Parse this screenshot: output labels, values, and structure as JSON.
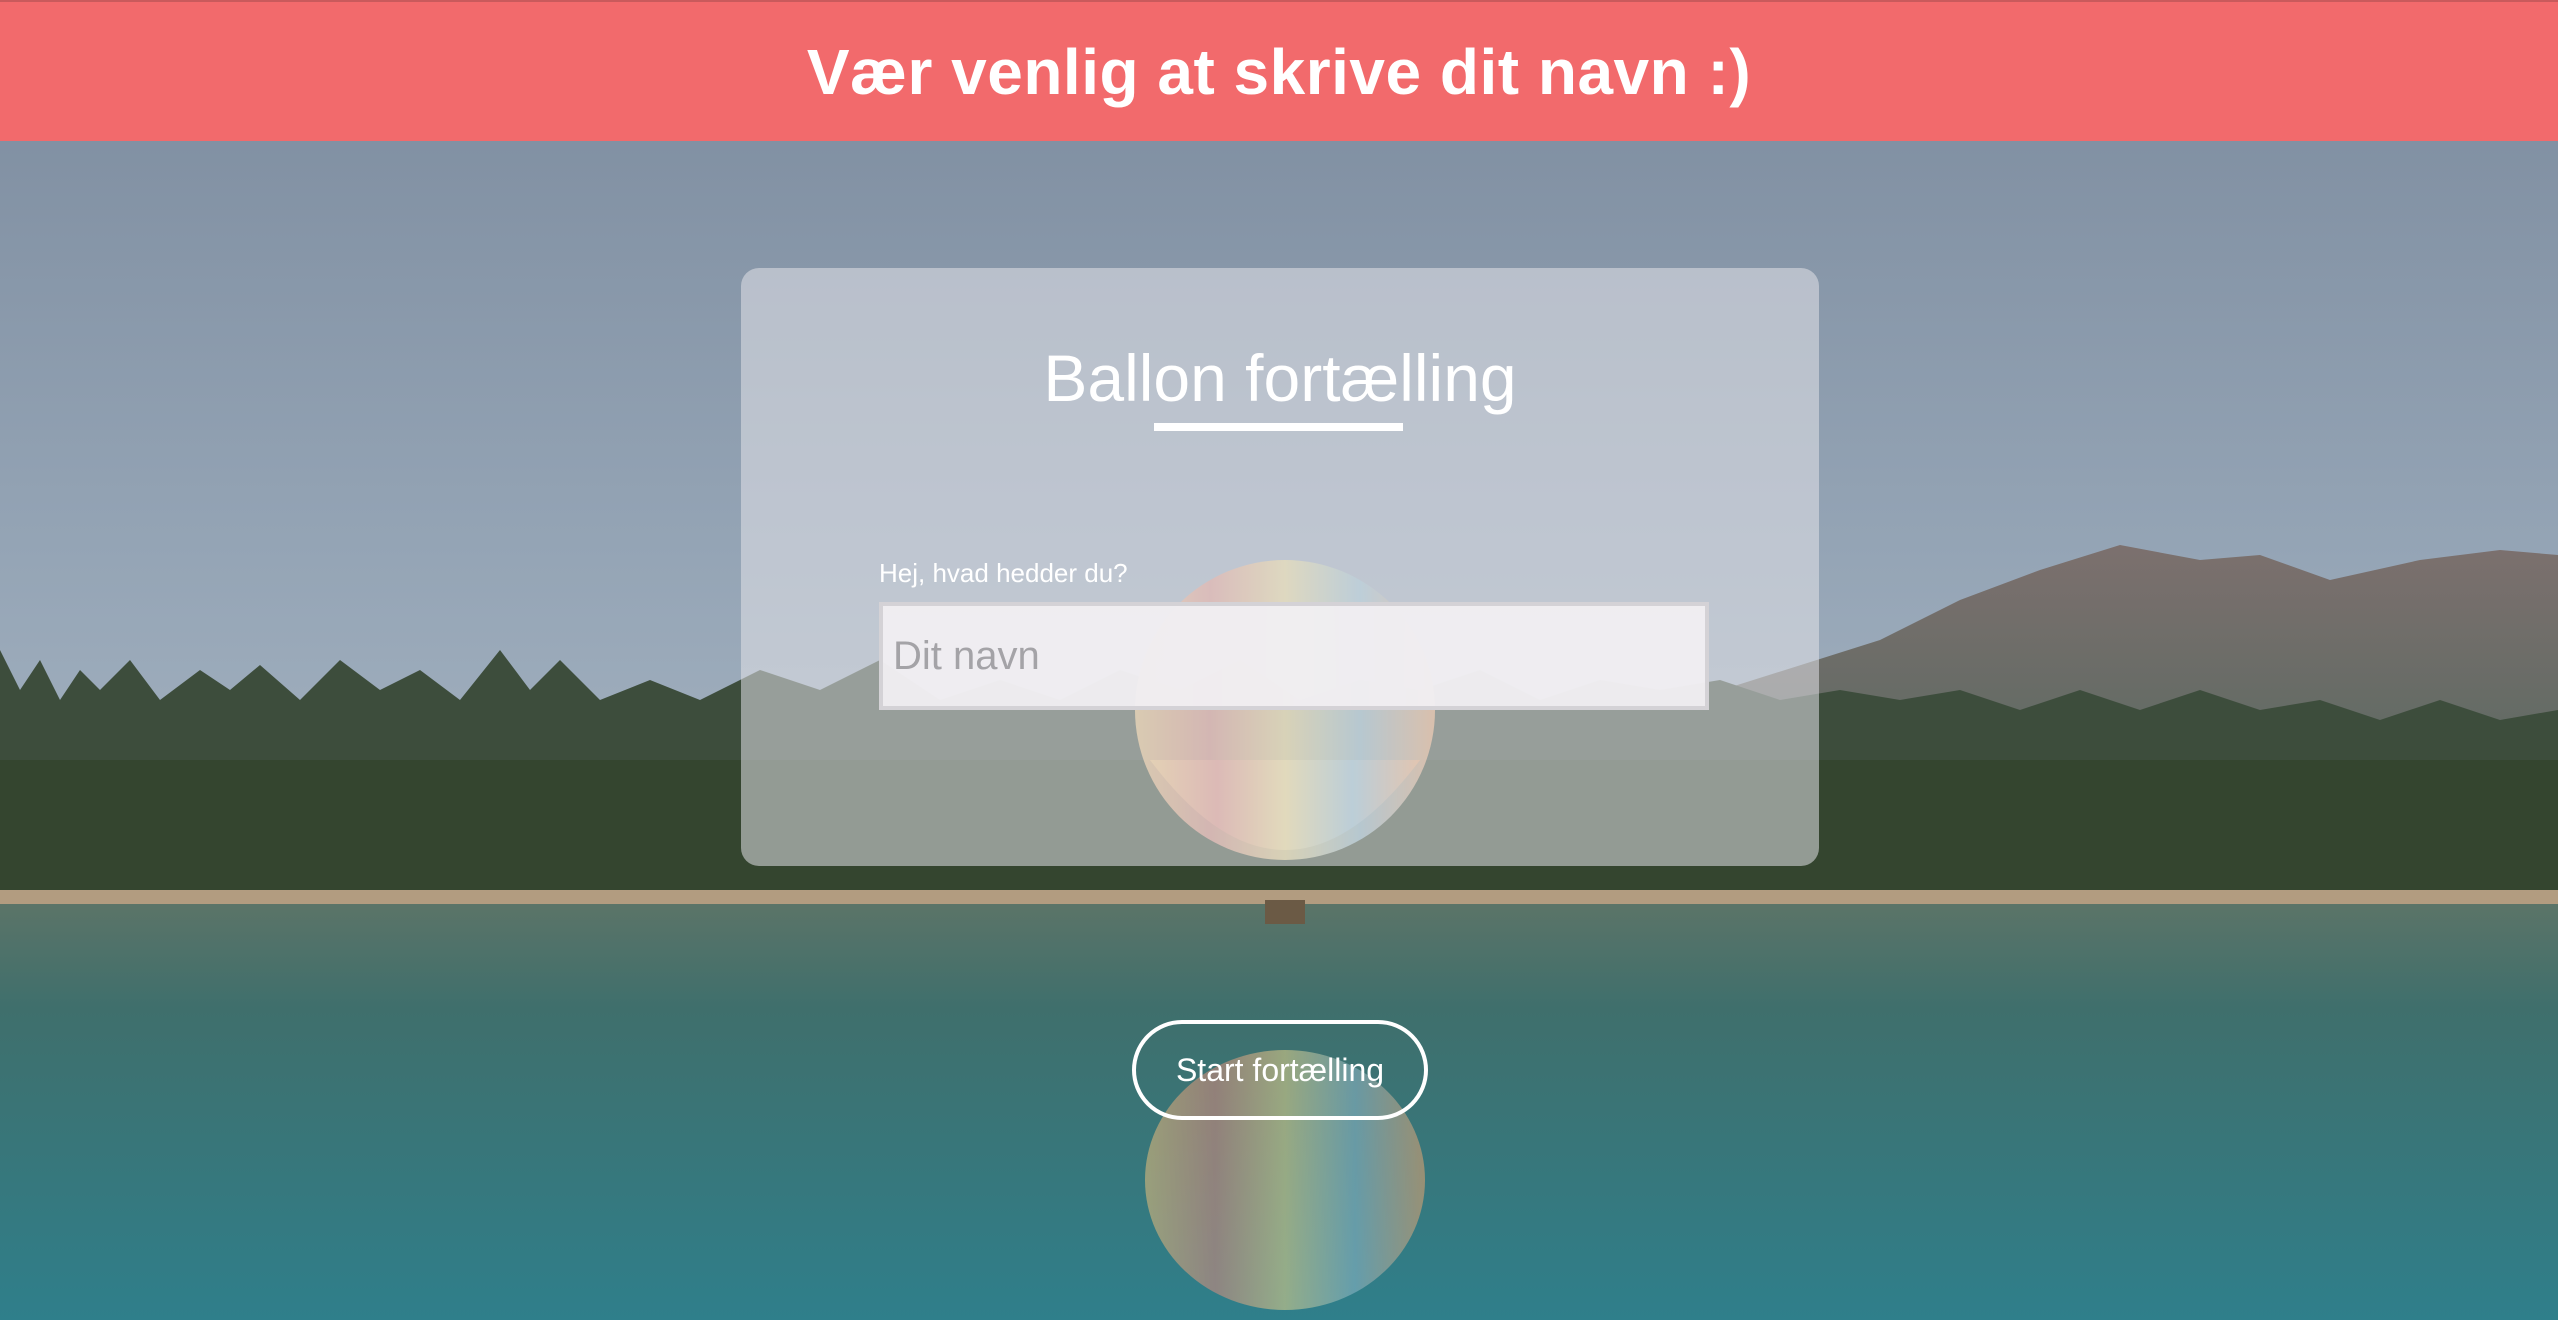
{
  "banner": {
    "text": "Vær venlig at skrive dit navn :)",
    "color": "#f26a6c"
  },
  "card": {
    "title": "Ballon fortælling",
    "name_label": "Hej, hvad hedder du?",
    "name_placeholder": "Dit navn",
    "name_value": ""
  },
  "start_button": {
    "label": "Start fortælling"
  }
}
